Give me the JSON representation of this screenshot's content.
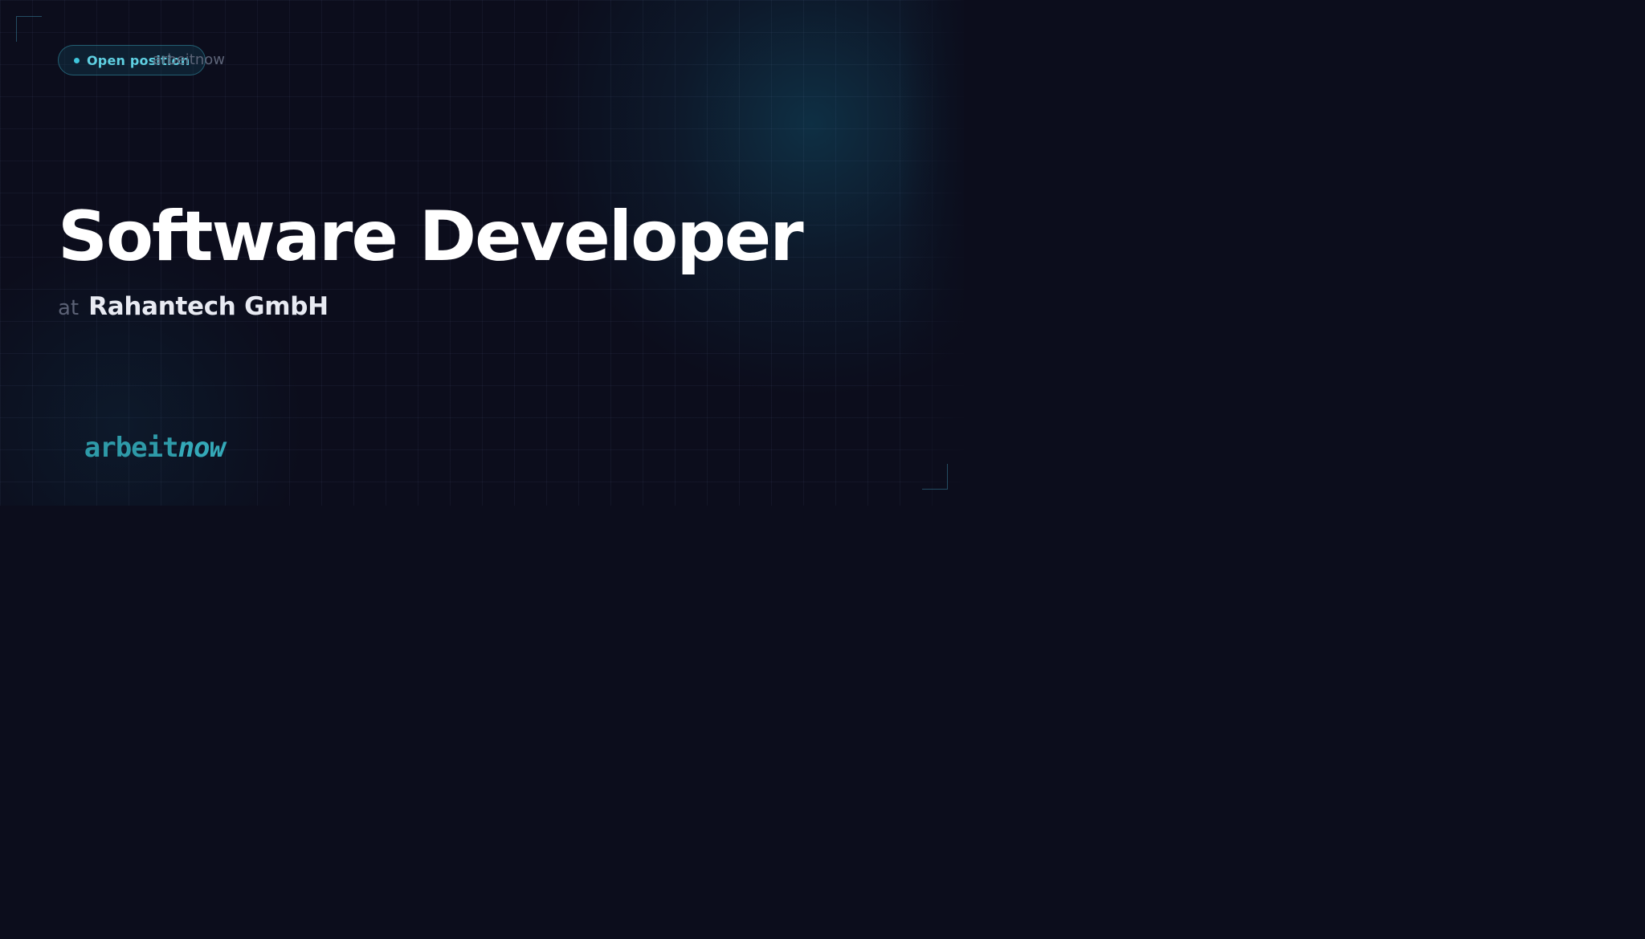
{
  "badge": {
    "label": "Open position"
  },
  "brand": {
    "name": "arbeitnow"
  },
  "job": {
    "title": "Software Developer",
    "at": "at",
    "company": "Rahantech GmbH"
  },
  "logo": {
    "part_a": "arbeit",
    "part_b": "now"
  },
  "colors": {
    "background": "#0c0d1c",
    "accent": "#3fc6dc",
    "logo": "#2e9aa8",
    "title": "#ffffff"
  },
  "icons": [
    "status-dot-icon",
    "corner-bracket-icon"
  ]
}
